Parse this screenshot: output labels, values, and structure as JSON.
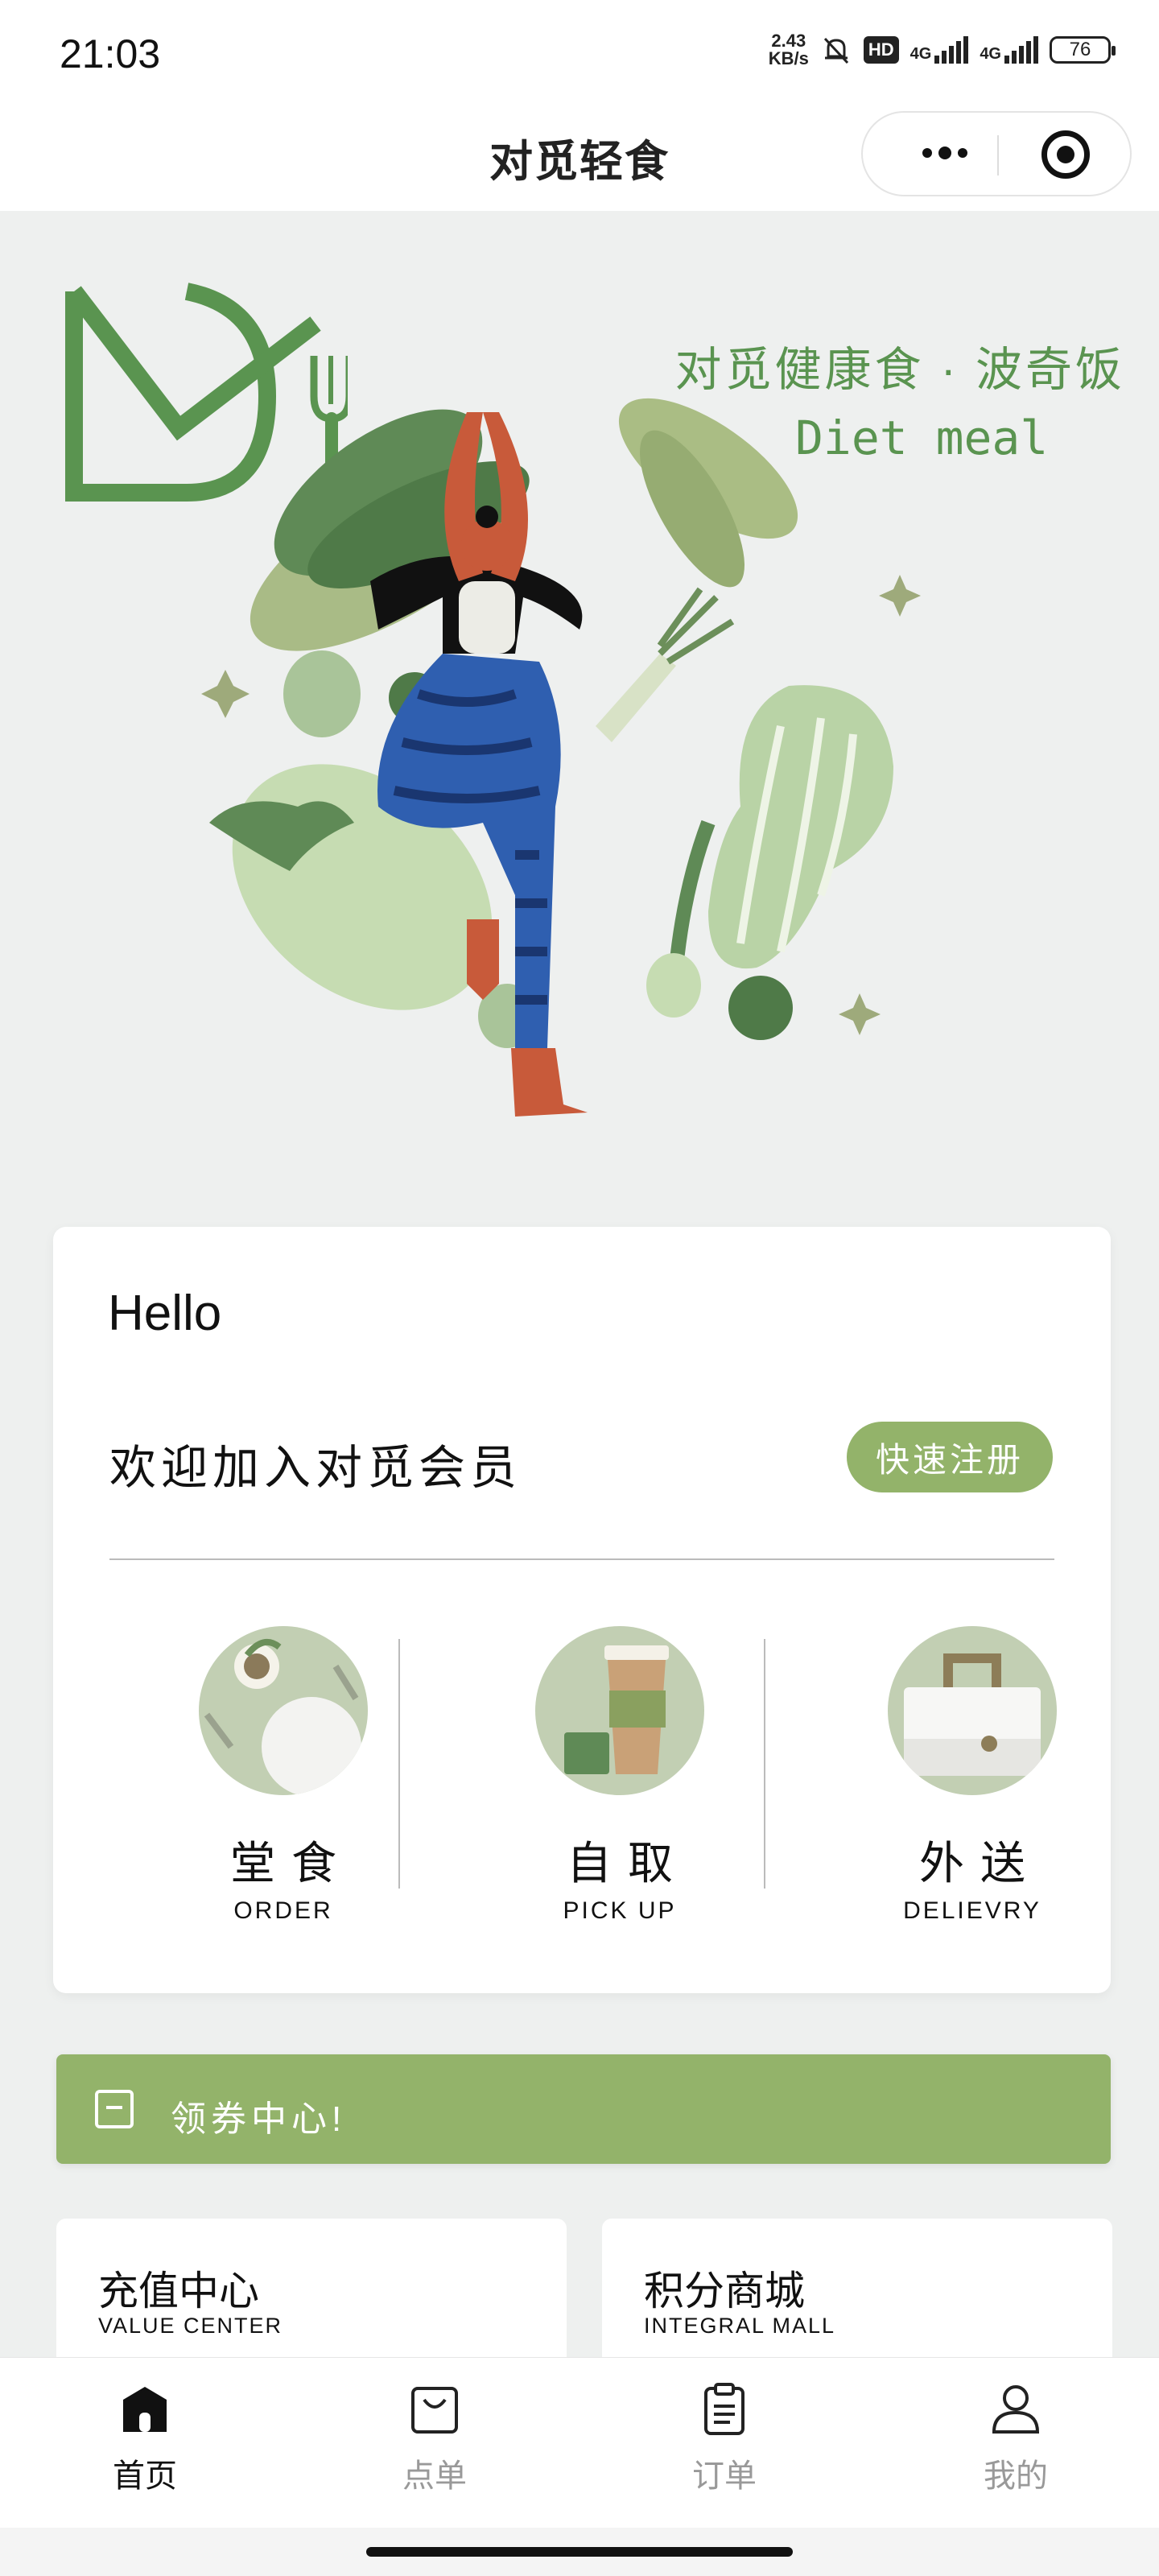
{
  "status_bar": {
    "time": "21:03",
    "speed_top": "2.43",
    "speed_bottom": "KB/s",
    "hd": "HD",
    "net1": "4G",
    "net2": "4G",
    "battery": "76"
  },
  "nav": {
    "title": "对觅轻食"
  },
  "hero": {
    "brand_cn": "对觅健康食 · 波奇饭",
    "brand_en": "Diet meal"
  },
  "member_card": {
    "greeting": "Hello",
    "welcome": "欢迎加入对觅会员",
    "register_label": "快速注册",
    "services": [
      {
        "cn": "堂食",
        "en": "ORDER"
      },
      {
        "cn": "自取",
        "en": "PICK UP"
      },
      {
        "cn": "外送",
        "en": "DELIEVRY"
      }
    ]
  },
  "coupon": {
    "label": "领券中心!"
  },
  "tiles": [
    {
      "cn": "充值中心",
      "en": "VALUE CENTER"
    },
    {
      "cn": "积分商城",
      "en": "INTEGRAL MALL"
    }
  ],
  "tabbar": [
    {
      "label": "首页",
      "icon": "home-icon",
      "active": true
    },
    {
      "label": "点单",
      "icon": "bag-icon",
      "active": false
    },
    {
      "label": "订单",
      "icon": "clipboard-icon",
      "active": false
    },
    {
      "label": "我的",
      "icon": "user-icon",
      "active": false
    }
  ],
  "colors": {
    "accent": "#93b36a",
    "brand_text": "#5a9450",
    "background": "#eef0ef"
  }
}
